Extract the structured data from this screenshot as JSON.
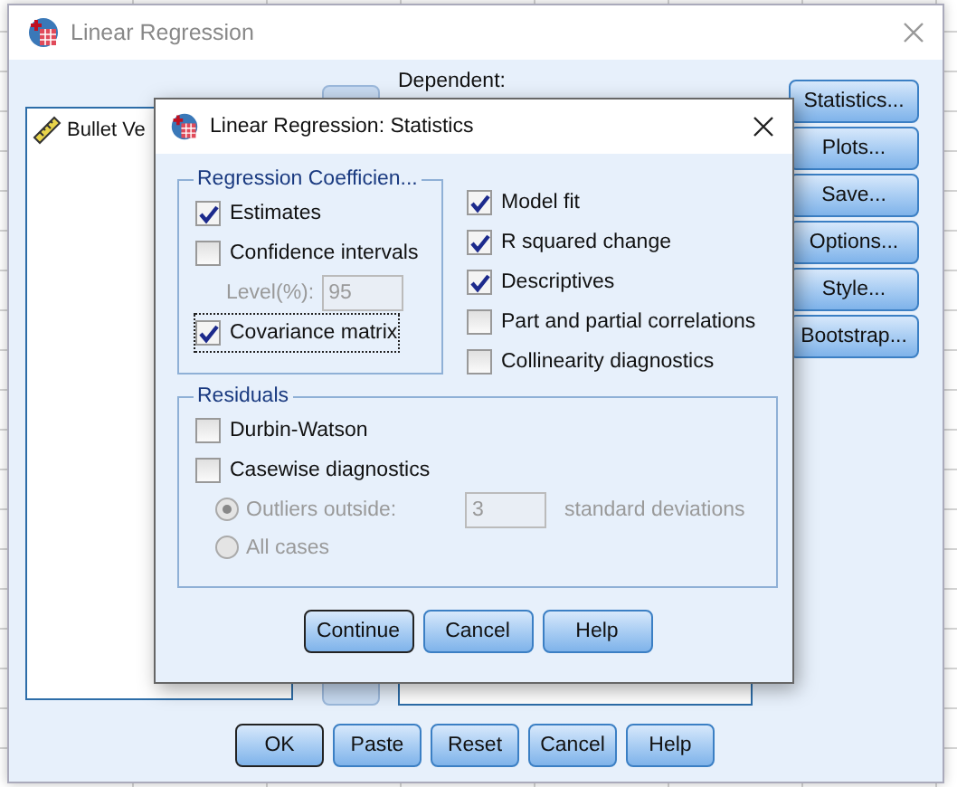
{
  "main_window": {
    "title": "Linear Regression",
    "variables": [
      {
        "name": "Bullet Ve",
        "kind": "scale"
      }
    ],
    "dependent_label": "Dependent:",
    "side_buttons": [
      {
        "label": "Statistics...",
        "default": false
      },
      {
        "label": "Plots...",
        "default": false
      },
      {
        "label": "Save...",
        "default": false
      },
      {
        "label": "Options...",
        "default": false
      },
      {
        "label": "Style...",
        "default": false
      },
      {
        "label": "Bootstrap...",
        "default": false
      }
    ],
    "buttons": [
      {
        "label": "OK",
        "default": true
      },
      {
        "label": "Paste",
        "default": false
      },
      {
        "label": "Reset",
        "default": false
      },
      {
        "label": "Cancel",
        "default": false
      },
      {
        "label": "Help",
        "default": false
      }
    ]
  },
  "dialog": {
    "title": "Linear Regression: Statistics",
    "coefficients": {
      "title": "Regression Coefficien...",
      "items": [
        {
          "kind": "checkbox",
          "label": "Estimates",
          "checked": true,
          "focused": false
        },
        {
          "kind": "checkbox",
          "label": "Confidence intervals",
          "checked": false,
          "focused": false
        },
        {
          "kind": "field",
          "label": "Level(%):",
          "value": "95",
          "disabled": true
        },
        {
          "kind": "checkbox",
          "label": "Covariance matrix",
          "checked": true,
          "focused": true
        }
      ]
    },
    "model_options": [
      {
        "label": "Model fit",
        "checked": true
      },
      {
        "label": "R squared change",
        "checked": true
      },
      {
        "label": "Descriptives",
        "checked": true
      },
      {
        "label": "Part and partial correlations",
        "checked": false
      },
      {
        "label": "Collinearity diagnostics",
        "checked": false
      }
    ],
    "residuals": {
      "title": "Residuals",
      "items": [
        {
          "kind": "checkbox",
          "label": "Durbin-Watson",
          "checked": false
        },
        {
          "kind": "checkbox",
          "label": "Casewise diagnostics",
          "checked": false
        },
        {
          "kind": "radio",
          "label": "Outliers outside:",
          "selected": true,
          "disabled": true,
          "value": "3",
          "suffix": "standard deviations"
        },
        {
          "kind": "radio",
          "label": "All cases",
          "selected": false,
          "disabled": true
        }
      ]
    },
    "buttons": [
      {
        "label": "Continue",
        "default": true
      },
      {
        "label": "Cancel",
        "default": false
      },
      {
        "label": "Help",
        "default": false
      }
    ]
  }
}
